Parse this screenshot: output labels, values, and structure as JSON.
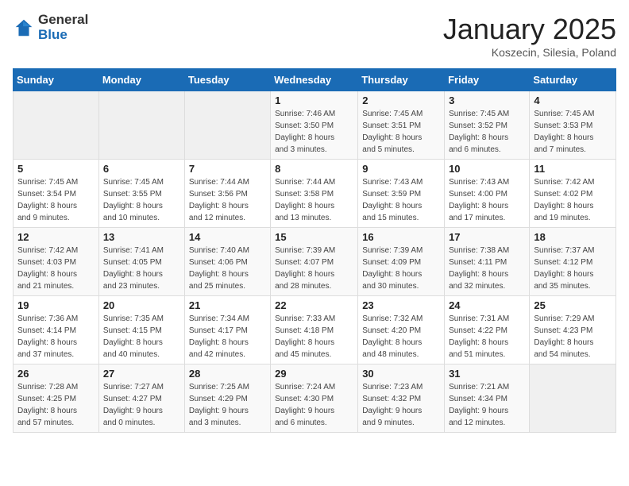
{
  "logo": {
    "general": "General",
    "blue": "Blue"
  },
  "title": "January 2025",
  "subtitle": "Koszecin, Silesia, Poland",
  "days_of_week": [
    "Sunday",
    "Monday",
    "Tuesday",
    "Wednesday",
    "Thursday",
    "Friday",
    "Saturday"
  ],
  "weeks": [
    [
      {
        "day": "",
        "details": ""
      },
      {
        "day": "",
        "details": ""
      },
      {
        "day": "",
        "details": ""
      },
      {
        "day": "1",
        "details": "Sunrise: 7:46 AM\nSunset: 3:50 PM\nDaylight: 8 hours\nand 3 minutes."
      },
      {
        "day": "2",
        "details": "Sunrise: 7:45 AM\nSunset: 3:51 PM\nDaylight: 8 hours\nand 5 minutes."
      },
      {
        "day": "3",
        "details": "Sunrise: 7:45 AM\nSunset: 3:52 PM\nDaylight: 8 hours\nand 6 minutes."
      },
      {
        "day": "4",
        "details": "Sunrise: 7:45 AM\nSunset: 3:53 PM\nDaylight: 8 hours\nand 7 minutes."
      }
    ],
    [
      {
        "day": "5",
        "details": "Sunrise: 7:45 AM\nSunset: 3:54 PM\nDaylight: 8 hours\nand 9 minutes."
      },
      {
        "day": "6",
        "details": "Sunrise: 7:45 AM\nSunset: 3:55 PM\nDaylight: 8 hours\nand 10 minutes."
      },
      {
        "day": "7",
        "details": "Sunrise: 7:44 AM\nSunset: 3:56 PM\nDaylight: 8 hours\nand 12 minutes."
      },
      {
        "day": "8",
        "details": "Sunrise: 7:44 AM\nSunset: 3:58 PM\nDaylight: 8 hours\nand 13 minutes."
      },
      {
        "day": "9",
        "details": "Sunrise: 7:43 AM\nSunset: 3:59 PM\nDaylight: 8 hours\nand 15 minutes."
      },
      {
        "day": "10",
        "details": "Sunrise: 7:43 AM\nSunset: 4:00 PM\nDaylight: 8 hours\nand 17 minutes."
      },
      {
        "day": "11",
        "details": "Sunrise: 7:42 AM\nSunset: 4:02 PM\nDaylight: 8 hours\nand 19 minutes."
      }
    ],
    [
      {
        "day": "12",
        "details": "Sunrise: 7:42 AM\nSunset: 4:03 PM\nDaylight: 8 hours\nand 21 minutes."
      },
      {
        "day": "13",
        "details": "Sunrise: 7:41 AM\nSunset: 4:05 PM\nDaylight: 8 hours\nand 23 minutes."
      },
      {
        "day": "14",
        "details": "Sunrise: 7:40 AM\nSunset: 4:06 PM\nDaylight: 8 hours\nand 25 minutes."
      },
      {
        "day": "15",
        "details": "Sunrise: 7:39 AM\nSunset: 4:07 PM\nDaylight: 8 hours\nand 28 minutes."
      },
      {
        "day": "16",
        "details": "Sunrise: 7:39 AM\nSunset: 4:09 PM\nDaylight: 8 hours\nand 30 minutes."
      },
      {
        "day": "17",
        "details": "Sunrise: 7:38 AM\nSunset: 4:11 PM\nDaylight: 8 hours\nand 32 minutes."
      },
      {
        "day": "18",
        "details": "Sunrise: 7:37 AM\nSunset: 4:12 PM\nDaylight: 8 hours\nand 35 minutes."
      }
    ],
    [
      {
        "day": "19",
        "details": "Sunrise: 7:36 AM\nSunset: 4:14 PM\nDaylight: 8 hours\nand 37 minutes."
      },
      {
        "day": "20",
        "details": "Sunrise: 7:35 AM\nSunset: 4:15 PM\nDaylight: 8 hours\nand 40 minutes."
      },
      {
        "day": "21",
        "details": "Sunrise: 7:34 AM\nSunset: 4:17 PM\nDaylight: 8 hours\nand 42 minutes."
      },
      {
        "day": "22",
        "details": "Sunrise: 7:33 AM\nSunset: 4:18 PM\nDaylight: 8 hours\nand 45 minutes."
      },
      {
        "day": "23",
        "details": "Sunrise: 7:32 AM\nSunset: 4:20 PM\nDaylight: 8 hours\nand 48 minutes."
      },
      {
        "day": "24",
        "details": "Sunrise: 7:31 AM\nSunset: 4:22 PM\nDaylight: 8 hours\nand 51 minutes."
      },
      {
        "day": "25",
        "details": "Sunrise: 7:29 AM\nSunset: 4:23 PM\nDaylight: 8 hours\nand 54 minutes."
      }
    ],
    [
      {
        "day": "26",
        "details": "Sunrise: 7:28 AM\nSunset: 4:25 PM\nDaylight: 8 hours\nand 57 minutes."
      },
      {
        "day": "27",
        "details": "Sunrise: 7:27 AM\nSunset: 4:27 PM\nDaylight: 9 hours\nand 0 minutes."
      },
      {
        "day": "28",
        "details": "Sunrise: 7:25 AM\nSunset: 4:29 PM\nDaylight: 9 hours\nand 3 minutes."
      },
      {
        "day": "29",
        "details": "Sunrise: 7:24 AM\nSunset: 4:30 PM\nDaylight: 9 hours\nand 6 minutes."
      },
      {
        "day": "30",
        "details": "Sunrise: 7:23 AM\nSunset: 4:32 PM\nDaylight: 9 hours\nand 9 minutes."
      },
      {
        "day": "31",
        "details": "Sunrise: 7:21 AM\nSunset: 4:34 PM\nDaylight: 9 hours\nand 12 minutes."
      },
      {
        "day": "",
        "details": ""
      }
    ]
  ]
}
